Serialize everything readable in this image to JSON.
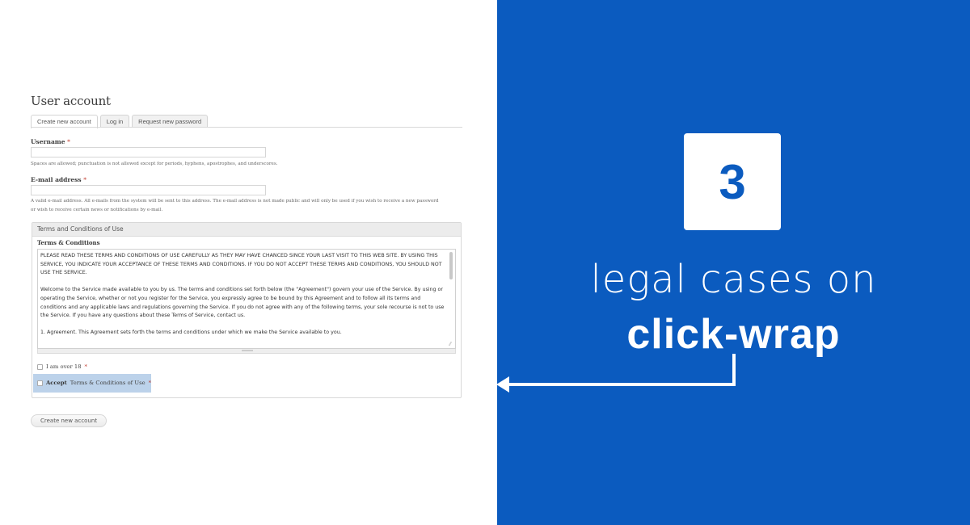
{
  "form": {
    "page_title": "User account",
    "tabs": [
      {
        "label": "Create new account",
        "active": true
      },
      {
        "label": "Log in",
        "active": false
      },
      {
        "label": "Request new password",
        "active": false
      }
    ],
    "username": {
      "label": "Username",
      "required_marker": "*",
      "value": "",
      "help": "Spaces are allowed; punctuation is not allowed except for periods, hyphens, apostrophes, and underscores."
    },
    "email": {
      "label": "E-mail address",
      "required_marker": "*",
      "value": "",
      "help_line1": "A valid e-mail address. All e-mails from the system will be sent to this address. The e-mail address is not made public and will only be used if you wish to receive a new password",
      "help_line2": "or wish to receive certain news or notifications by e-mail."
    },
    "terms_fieldset": {
      "legend": "Terms and Conditions of Use",
      "label": "Terms & Conditions",
      "paragraphs": [
        "PLEASE READ THESE TERMS AND CONDITIONS OF USE CAREFULLY AS THEY MAY HAVE CHANCED SINCE YOUR LAST VISIT TO THIS WEB SITE. BY USING THIS SERVICE, YOU INDICATE YOUR ACCEPTANCE OF THESE TERMS AND CONDITIONS. IF YOU DO NOT ACCEPT THESE TERMS AND CONDITIONS, YOU SHOULD NOT USE THE SERVICE.",
        "Welcome to the Service made available to you by us. The terms and conditions set forth below (the \"Agreement\") govern your use of the Service. By using or operating the Service, whether or not you register for the Service, you expressly agree to be bound by this Agreement and to follow all its terms and conditions and any applicable laws and regulations governing the Service. If you do not agree with any of the following terms, your sole recourse is not to use the Service. If you have any questions about these Terms of Service, contact us.",
        "1. Agreement. This Agreement sets forth the terms and conditions under which we make the Service available to you."
      ],
      "over18": {
        "label": "I am over 18",
        "required_marker": "*",
        "checked": false
      },
      "accept": {
        "bold": "Accept",
        "label": "Terms & Conditions of Use",
        "required_marker": "*",
        "checked": false
      }
    },
    "submit_label": "Create new account"
  },
  "promo": {
    "number": "3",
    "line1": "legal cases on",
    "line2": "click-wrap",
    "arrow_icon": "arrow-left-elbow"
  },
  "colors": {
    "brand_blue": "#0b5bbf",
    "highlight": "#bcd2ea",
    "required_red": "#c0392b"
  }
}
